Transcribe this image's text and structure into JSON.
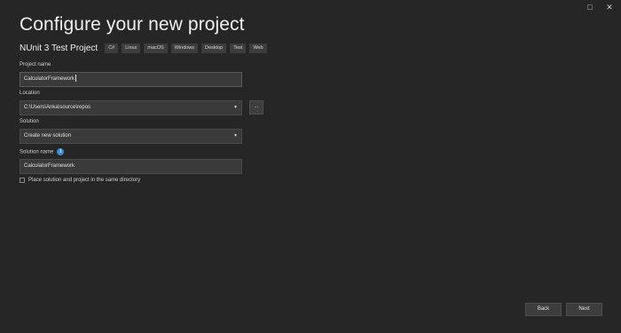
{
  "window": {
    "restore_icon": "□",
    "close_icon": "✕"
  },
  "page": {
    "title": "Configure your new project"
  },
  "template": {
    "name": "NUnit 3 Test Project",
    "tags": [
      "C#",
      "Linux",
      "macOS",
      "Windows",
      "Desktop",
      "Test",
      "Web"
    ]
  },
  "project_name": {
    "label": "Project name",
    "value": "CalculatorFramework"
  },
  "location": {
    "label": "Location",
    "value": "C:\\Users\\Anka\\source\\repos",
    "browse_label": "..."
  },
  "solution": {
    "label": "Solution",
    "value": "Create new solution"
  },
  "solution_name": {
    "label": "Solution name",
    "value": "CalculatorFramework",
    "info_icon": "i"
  },
  "same_dir": {
    "label": "Place solution and project in the same directory",
    "checked": false
  },
  "footer": {
    "back_label": "Back",
    "next_label": "Next"
  },
  "colors": {
    "background": "#262626",
    "field_bg": "#3a3a3a",
    "info_accent": "#3c8ad8"
  }
}
